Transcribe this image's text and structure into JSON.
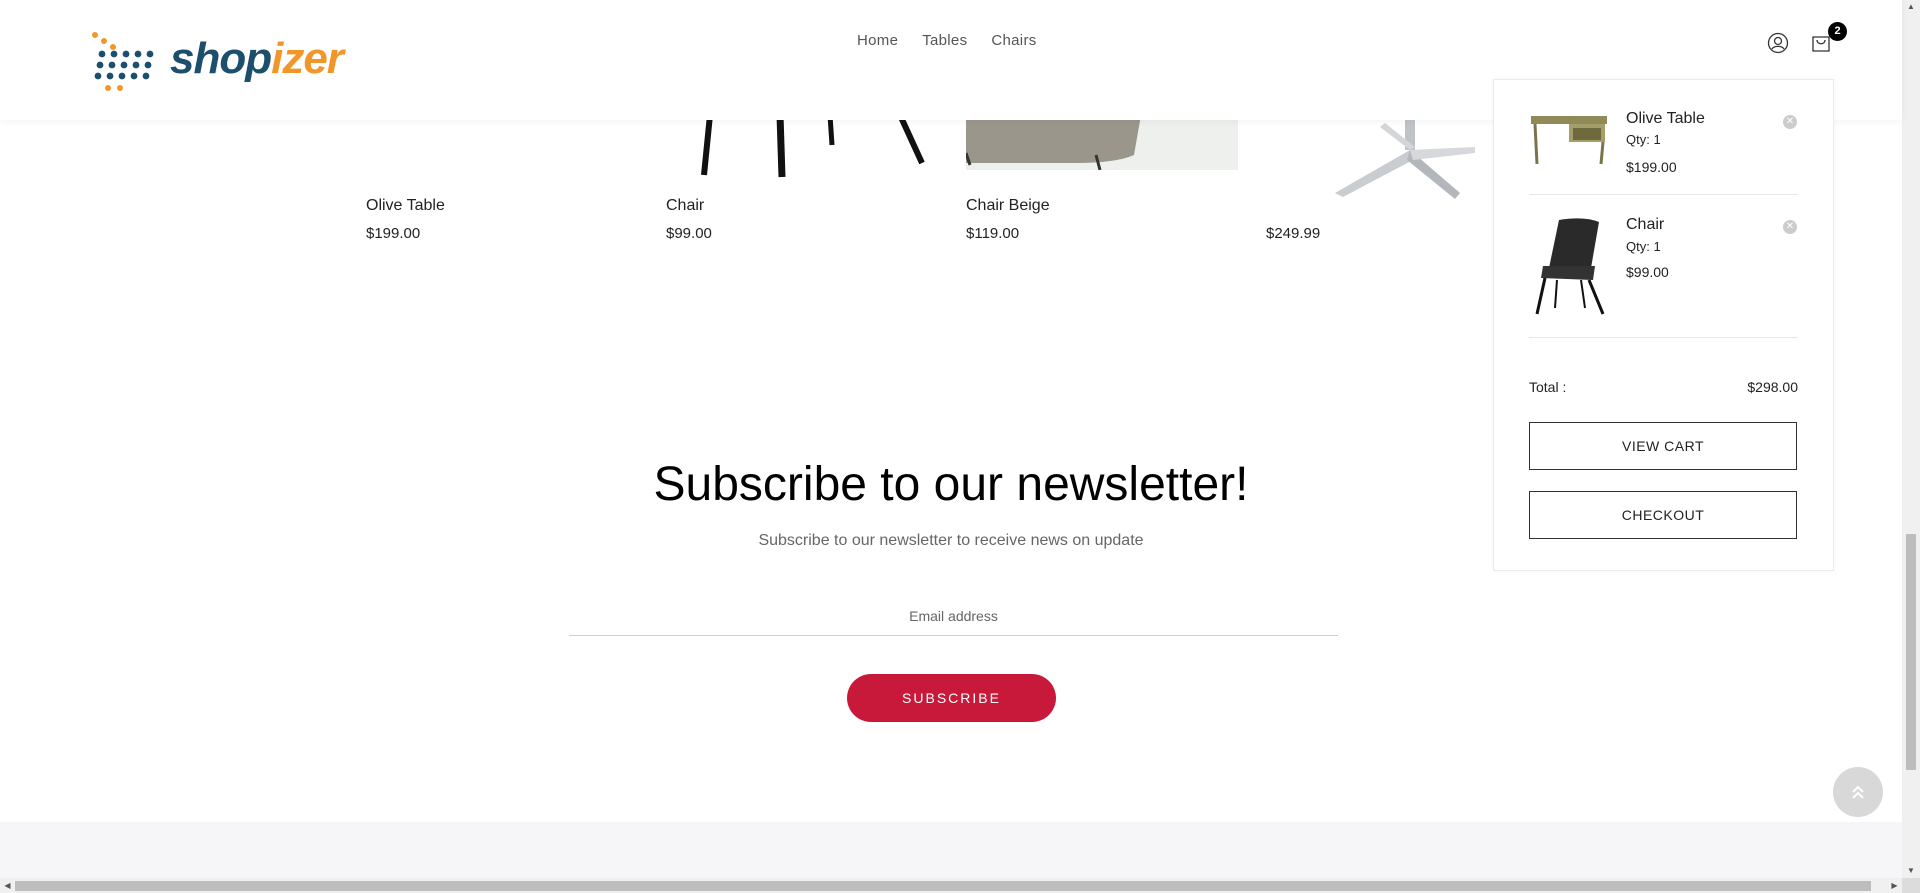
{
  "brand": {
    "logo_part1": "shop",
    "logo_part2": "izer"
  },
  "nav": {
    "items": [
      "Home",
      "Tables",
      "Chairs"
    ]
  },
  "header": {
    "cart_count": "2",
    "user_icon": "user-icon",
    "cart_icon": "cart-icon"
  },
  "products": [
    {
      "name": "Olive Table",
      "price": "$199.00"
    },
    {
      "name": "Chair",
      "price": "$99.00"
    },
    {
      "name": "Chair Beige",
      "price": "$119.00"
    },
    {
      "name": "",
      "price": "$249.99"
    }
  ],
  "newsletter": {
    "title": "Subscribe to our newsletter!",
    "subtitle": "Subscribe to our newsletter to receive news on update",
    "email_placeholder": "Email address",
    "button_label": "SUBSCRIBE"
  },
  "cart": {
    "items": [
      {
        "name": "Olive Table",
        "qty": "Qty: 1",
        "price": "$199.00"
      },
      {
        "name": "Chair",
        "qty": "Qty: 1",
        "price": "$99.00"
      }
    ],
    "total_label": "Total :",
    "total_value": "$298.00",
    "view_cart_label": "VIEW CART",
    "checkout_label": "CHECKOUT"
  },
  "colors": {
    "accent": "#c8193a",
    "logo_blue": "#1c4e6e",
    "logo_orange": "#f2962a"
  }
}
